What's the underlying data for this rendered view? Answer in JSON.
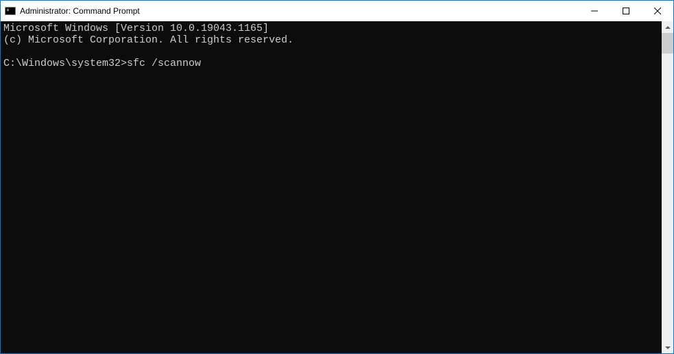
{
  "window": {
    "title": "Administrator: Command Prompt"
  },
  "console": {
    "line1": "Microsoft Windows [Version 10.0.19043.1165]",
    "line2": "(c) Microsoft Corporation. All rights reserved.",
    "blank": "",
    "prompt": "C:\\Windows\\system32>",
    "command": "sfc /scannow"
  }
}
